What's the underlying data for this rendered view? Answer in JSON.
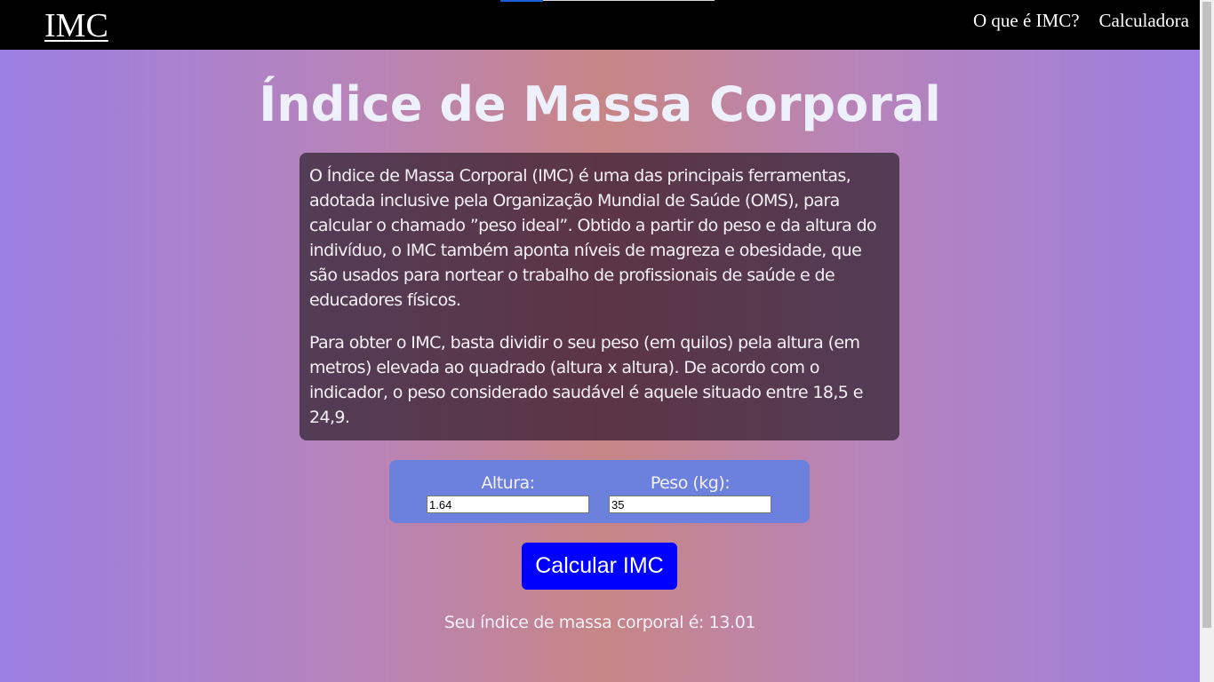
{
  "nav": {
    "brand": "IMC",
    "links": [
      "O que é IMC?",
      "Calculadora"
    ]
  },
  "main": {
    "title": "Índice de Massa Corporal",
    "paragraphs": [
      "O Índice de Massa Corporal (IMC) é uma das principais ferramentas, adotada inclusive pela Organização Mundial de Saúde (OMS), para calcular o chamado ”peso ideal”. Obtido a partir do peso e da altura do indivíduo, o IMC também aponta níveis de magreza e obesidade, que são usados para nortear o trabalho de profissionais de saúde e de educadores físicos.",
      "Para obter o IMC, basta dividir o seu peso (em quilos) pela altura (em metros) elevada ao quadrado (altura x altura). De acordo com o indicador, o peso considerado saudável é aquele situado entre 18,5 e 24,9."
    ]
  },
  "form": {
    "altura_label": "Altura:",
    "altura_value": "1.64",
    "peso_label": "Peso (kg):",
    "peso_value": "35",
    "button_label": "Calcular IMC"
  },
  "result": {
    "text": "Seu índice de massa corporal é: 13.01"
  },
  "colors": {
    "navbar": "#000000",
    "button": "#0000ff",
    "form_box": "#6c80de",
    "info_box": "#5c3545"
  }
}
